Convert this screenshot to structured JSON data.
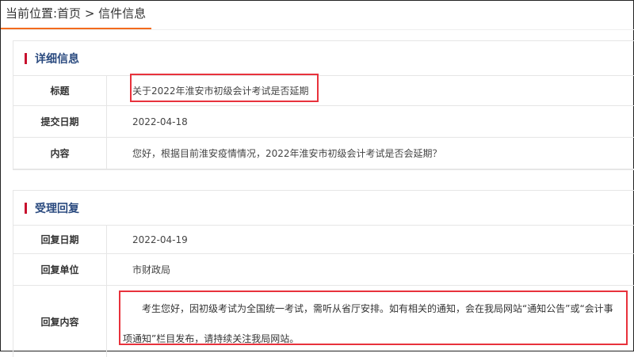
{
  "breadcrumb": "当前位置:首页 > 信件信息",
  "details": {
    "title": "详细信息",
    "rows": [
      {
        "label": "标题",
        "value": "关于2022年淮安市初级会计考试是否延期"
      },
      {
        "label": "提交日期",
        "value": "2022-04-18"
      },
      {
        "label": "内容",
        "value": "您好，根据目前淮安疫情情况，2022年淮安市初级会计考试是否会延期？"
      }
    ]
  },
  "reply": {
    "title": "受理回复",
    "rows": [
      {
        "label": "回复日期",
        "value": "2022-04-19"
      },
      {
        "label": "回复单位",
        "value": "市财政局"
      },
      {
        "label": "回复内容",
        "value": "考生您好，因初级考试为全国统一考试，需听从省厅安排。如有相关的通知，会在我局网站“通知公告”或“会计事项通知”栏目发布，请持续关注我局网站。"
      }
    ]
  },
  "colors": {
    "accent": "#f26b1d",
    "section_bar": "#c8102e",
    "highlight": "#e8323c"
  }
}
